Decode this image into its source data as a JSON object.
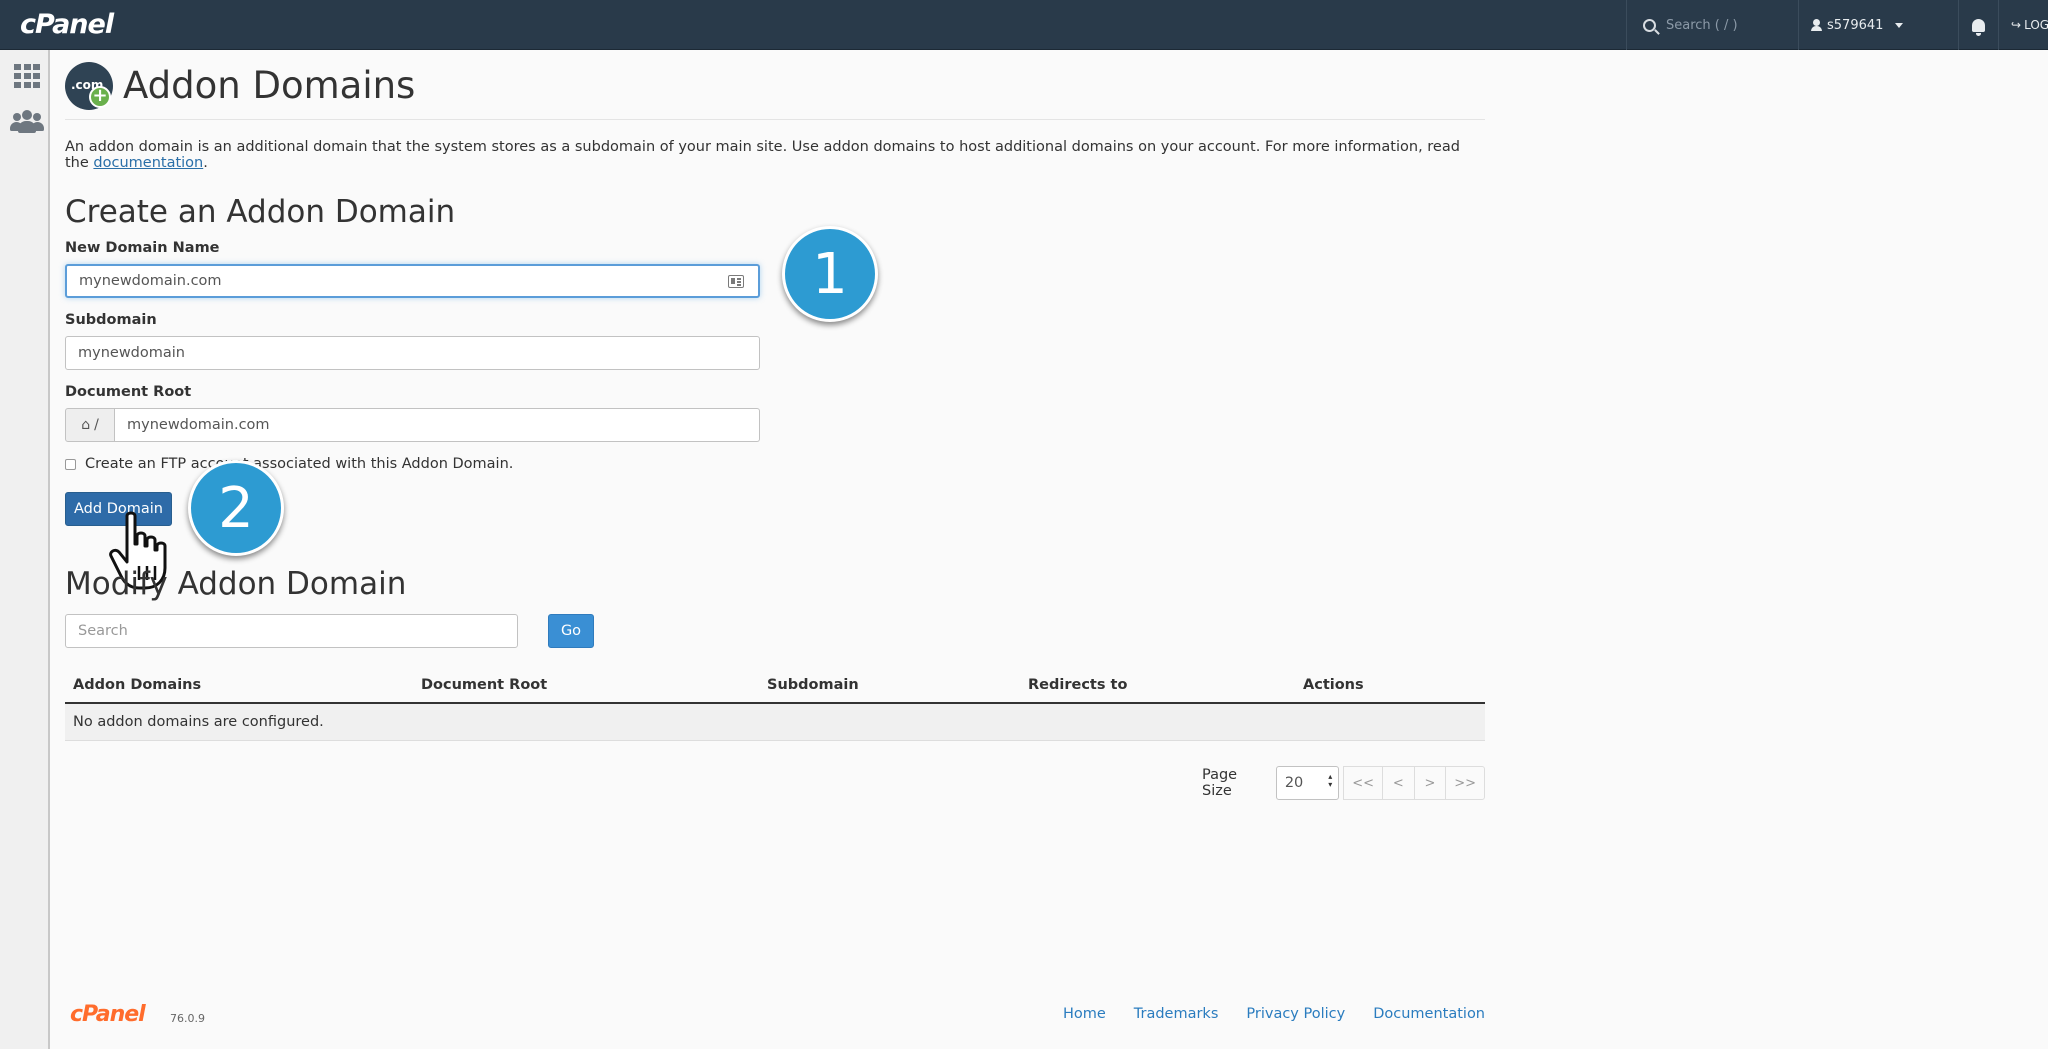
{
  "topbar": {
    "logo": "cPanel",
    "search_placeholder": "Search ( / )",
    "username": "s579641",
    "logout_label": "LOGOUT"
  },
  "page": {
    "title": "Addon Domains",
    "icon_text": ".com",
    "description": "An addon domain is an additional domain that the system stores as a subdomain of your main site. Use addon domains to host additional domains on your account. For more information, read the ",
    "description_link": "documentation",
    "description_end": "."
  },
  "create": {
    "title": "Create an Addon Domain",
    "new_domain_label": "New Domain Name",
    "new_domain_value": "mynewdomain.com",
    "subdomain_label": "Subdomain",
    "subdomain_value": "mynewdomain",
    "docroot_label": "Document Root",
    "docroot_prefix": "/",
    "docroot_value": "mynewdomain.com",
    "ftp_checkbox_label": "Create an FTP account associated with this Addon Domain.",
    "ftp_checked": false,
    "add_button": "Add Domain"
  },
  "steps": {
    "step1": "1",
    "step2": "2"
  },
  "modify": {
    "title": "Modify Addon Domain",
    "search_placeholder": "Search",
    "go_button": "Go",
    "columns": [
      "Addon Domains",
      "Document Root",
      "Subdomain",
      "Redirects to",
      "Actions"
    ],
    "empty_message": "No addon domains are configured.",
    "page_size_label": "Page Size",
    "page_size_value": "20",
    "pager": [
      "<<",
      "<",
      ">",
      ">>"
    ]
  },
  "footer": {
    "logo": "cPanel",
    "version": "76.0.9",
    "links": [
      "Home",
      "Trademarks",
      "Privacy Policy",
      "Documentation"
    ]
  },
  "colors": {
    "topbar": "#293a4a",
    "primary_button": "#2e6ba8",
    "step_circle": "#2d9bd2",
    "link": "#2a7cbf",
    "cpanel_orange": "#ff6c2c"
  }
}
